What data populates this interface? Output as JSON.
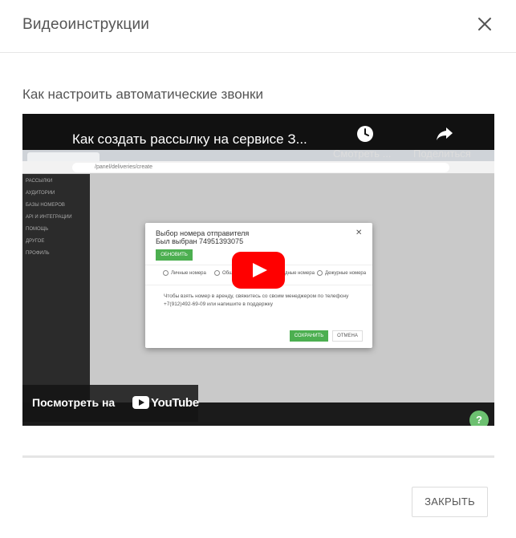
{
  "modal": {
    "title": "Видеоинструкции",
    "subtitle": "Как настроить автоматические звонки",
    "close_button": "ЗАКРЫТЬ"
  },
  "video": {
    "title": "Как создать рассылку на сервисе З...",
    "watch_later": "Смотреть ...",
    "share": "Поделиться",
    "watch_on": "Посмотреть на",
    "youtube": "YouTube",
    "embedded": {
      "url": "/panel/deliveries/create",
      "sidebar": [
        "РАССЫЛКИ",
        "АУДИТОРИИ",
        "БАЗЫ НОМЕРОВ",
        "API И ИНТЕГРАЦИИ",
        "ПОМОЩЬ",
        "ДРУГОЕ",
        "ПРОФИЛЬ"
      ],
      "dialog": {
        "title": "Выбор номера отправителя",
        "selected": "Был выбран 74951393075",
        "update": "ОБНОВИТЬ",
        "radios": [
          "Личные номера",
          "Общие номера",
          "Арендные номера",
          "Дежурные номера"
        ],
        "text": "Чтобы взять номер в аренду, свяжитесь со своим менеджером по телефону +7(912)492-69-09 или напишите в поддержку",
        "save": "СОХРАНИТЬ",
        "cancel": "ОТМЕНА"
      },
      "help": "?"
    }
  }
}
